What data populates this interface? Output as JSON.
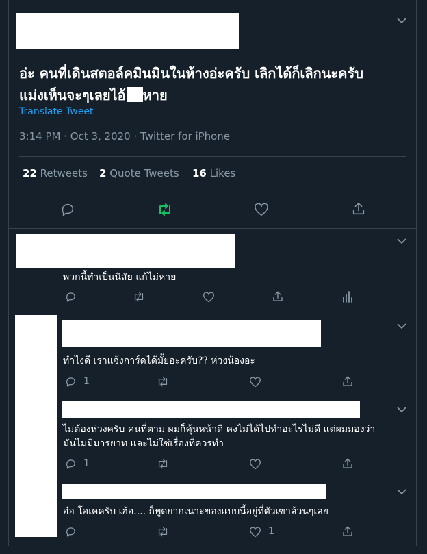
{
  "main_tweet": {
    "text_line1": "อ่ะ คนที่เดินสตอล์คมินมินในห้างอ่ะครับ เลิกได้ก็เลิกนะครับ",
    "text_line2_a": "แม่งเห็นจะๆเลยไอ้",
    "text_line2_b": "หาย",
    "translate_label": "Translate Tweet",
    "meta": "3:14 PM · Oct 3, 2020 · Twitter for iPhone",
    "stats": {
      "retweets_count": "22",
      "retweets_label": "Retweets",
      "quotes_count": "2",
      "quotes_label": "Quote Tweets",
      "likes_count": "16",
      "likes_label": "Likes"
    }
  },
  "reply1": {
    "text": "พวกนี้ทำเป็นนิสัย แก้ไม่หาย"
  },
  "thread_replies": [
    {
      "text": "ทำไงดี เราแจ้งการ์ดได้มั้ยอะครับ?? ห่วงน้องอะ",
      "reply_count": "1",
      "like_count": ""
    },
    {
      "text_line1": "ไม่ต้องห่วงครับ คนที่ตาม ผมก็คุ้นหน้าดี คงไม่ได้ไปทำอะไรไม่ดี แต่ผมมองว่า",
      "text_line2": "มันไม่มีมารยาท และไม่ใช่เรื่องที่ควรทำ",
      "reply_count": "1",
      "like_count": ""
    },
    {
      "text": "อ๋อ โอเคครับ เฮ้อ.... ก็พูดยากเนาะของแบบนี้อยู่ที่ตัวเขาล้วนๆเลย",
      "reply_count": "",
      "like_count": "1"
    }
  ],
  "colors": {
    "background": "#15202b",
    "border": "#38444d",
    "secondary_text": "#8899a6",
    "link": "#1da1f2",
    "retweet_active": "#17bf63"
  }
}
